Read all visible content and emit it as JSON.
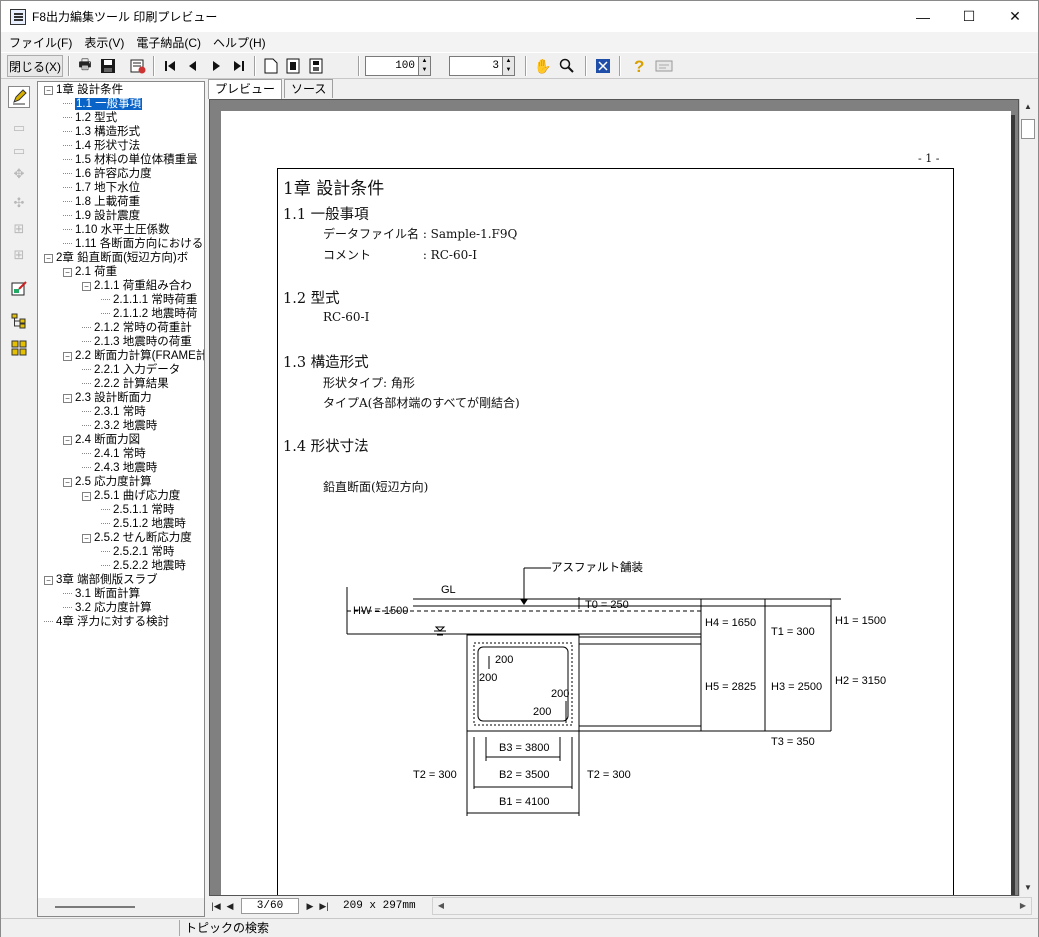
{
  "window": {
    "title": "F8出力編集ツール 印刷プレビュー",
    "controls": [
      "—",
      "☐",
      "✕"
    ]
  },
  "menu": [
    "ファイル(F)",
    "表示(V)",
    "電子納品(C)",
    "ヘルプ(H)"
  ],
  "toolbar": {
    "close_label": "閉じる(X)",
    "zoom_value": "100",
    "pages_value": "3"
  },
  "tree": [
    {
      "label": "1章 設計条件",
      "level": 0,
      "expander": "⊟"
    },
    {
      "label": "1.1 一般事項",
      "level": 1,
      "selected": true
    },
    {
      "label": "1.2 型式",
      "level": 1
    },
    {
      "label": "1.3 構造形式",
      "level": 1
    },
    {
      "label": "1.4 形状寸法",
      "level": 1
    },
    {
      "label": "1.5 材料の単位体積重量",
      "level": 1
    },
    {
      "label": "1.6 許容応力度",
      "level": 1
    },
    {
      "label": "1.7 地下水位",
      "level": 1
    },
    {
      "label": "1.8 上載荷重",
      "level": 1
    },
    {
      "label": "1.9 設計震度",
      "level": 1
    },
    {
      "label": "1.10 水平土圧係数",
      "level": 1
    },
    {
      "label": "1.11 各断面方向における",
      "level": 1
    },
    {
      "label": "2章 鉛直断面(短辺方向)ボ",
      "level": 0,
      "expander": "⊟"
    },
    {
      "label": "2.1 荷重",
      "level": 1,
      "expander": "⊟"
    },
    {
      "label": "2.1.1 荷重組み合わ",
      "level": 2,
      "expander": "⊟"
    },
    {
      "label": "2.1.1.1 常時荷重",
      "level": 3
    },
    {
      "label": "2.1.1.2 地震時荷",
      "level": 3
    },
    {
      "label": "2.1.2 常時の荷重計",
      "level": 2
    },
    {
      "label": "2.1.3 地震時の荷重",
      "level": 2
    },
    {
      "label": "2.2 断面力計算(FRAME計",
      "level": 1,
      "expander": "⊟"
    },
    {
      "label": "2.2.1 入力データ",
      "level": 2
    },
    {
      "label": "2.2.2 計算結果",
      "level": 2
    },
    {
      "label": "2.3 設計断面力",
      "level": 1,
      "expander": "⊟"
    },
    {
      "label": "2.3.1 常時",
      "level": 2
    },
    {
      "label": "2.3.2 地震時",
      "level": 2
    },
    {
      "label": "2.4 断面力図",
      "level": 1,
      "expander": "⊟"
    },
    {
      "label": "2.4.1 常時",
      "level": 2
    },
    {
      "label": "2.4.3 地震時",
      "level": 2
    },
    {
      "label": "2.5 応力度計算",
      "level": 1,
      "expander": "⊟"
    },
    {
      "label": "2.5.1 曲げ応力度",
      "level": 2,
      "expander": "⊟"
    },
    {
      "label": "2.5.1.1 常時",
      "level": 3
    },
    {
      "label": "2.5.1.2 地震時",
      "level": 3
    },
    {
      "label": "2.5.2 せん断応力度",
      "level": 2,
      "expander": "⊟"
    },
    {
      "label": "2.5.2.1 常時",
      "level": 3
    },
    {
      "label": "2.5.2.2 地震時",
      "level": 3
    },
    {
      "label": "3章 端部側版スラブ",
      "level": 0,
      "expander": "⊟"
    },
    {
      "label": "3.1 断面計算",
      "level": 1
    },
    {
      "label": "3.2 応力度計算",
      "level": 1
    },
    {
      "label": "4章 浮力に対する検討",
      "level": 0
    }
  ],
  "tabs": {
    "preview": "プレビュー",
    "source": "ソース"
  },
  "page": {
    "number": "- 1 -",
    "chapter": "1章 設計条件",
    "s11": "1.1 一般事項",
    "data_file": "データファイル名 : Sample-1.F9Q",
    "comment": "コメント　　　　 : RC-60-I",
    "s12": "1.2 型式",
    "model": "RC-60-I",
    "s13": "1.3 構造形式",
    "shape_type": "形状タイプ: 角形",
    "type_a": "タイプA(各部材端のすべてが剛結合)",
    "s14": "1.4 形状寸法",
    "section_caption": "鉛直断面(短辺方向)"
  },
  "drawing": {
    "asphalt": "アスファルト舗装",
    "gl": "GL",
    "hw": "HW = 1500",
    "t0": "T0 = 250",
    "h4": "H4 = 1650",
    "t1": "T1 = 300",
    "h1": "H1 = 1500",
    "h5": "H5 = 2825",
    "h3": "H3 = 2500",
    "h2": "H2 = 3150",
    "t3": "T3 = 350",
    "b3": "B3 = 3800",
    "b2": "B2 = 3500",
    "b1": "B1 = 4100",
    "t2l": "T2 = 300",
    "t2r": "T2 = 300",
    "h200a": "200",
    "h200b": "200",
    "h200c": "200",
    "h200d": "200"
  },
  "navbar": {
    "page": "3/60",
    "size": "209 x 297mm"
  },
  "status": {
    "topic_search": "トピックの検索"
  }
}
